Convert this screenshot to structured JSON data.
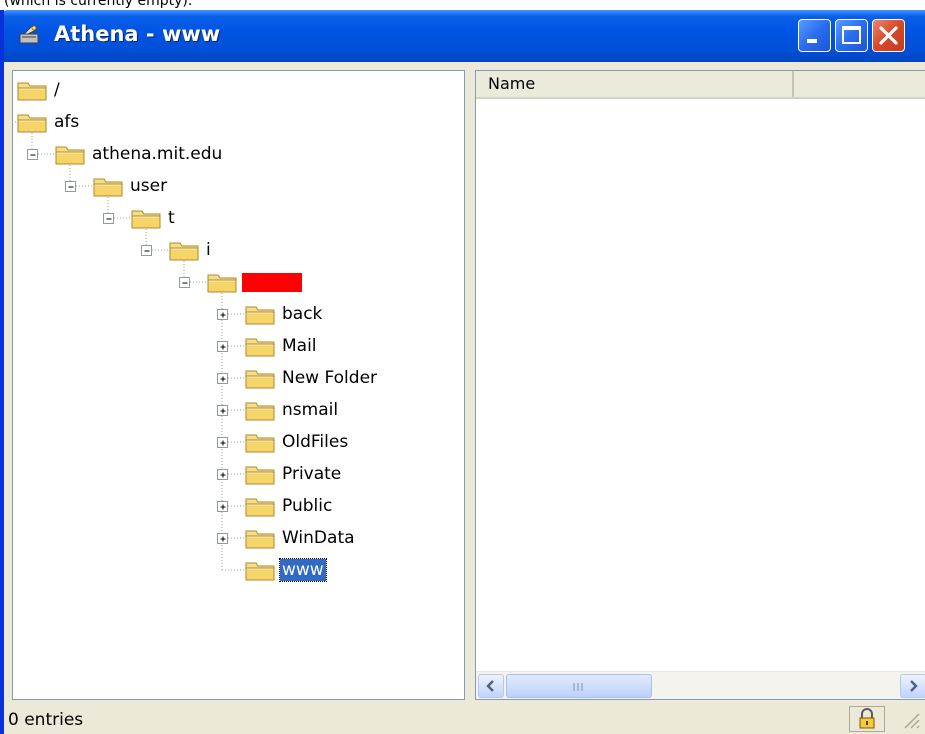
{
  "caption": "(which is currently empty).",
  "window": {
    "title": "Athena - www",
    "app_icon": "athena-app-icon",
    "buttons": {
      "minimize": "minimize-icon",
      "maximize": "maximize-icon",
      "close": "close-icon"
    }
  },
  "tree": {
    "nodes": [
      {
        "label": "/",
        "expander": "none"
      },
      {
        "label": "afs",
        "expander": "minus"
      },
      {
        "label": "athena.mit.edu",
        "expander": "minus"
      },
      {
        "label": "user",
        "expander": "minus"
      },
      {
        "label": "t",
        "expander": "minus"
      },
      {
        "label": "i",
        "expander": "minus"
      },
      {
        "label": "",
        "expander": "minus",
        "redacted": true
      },
      {
        "label": "back",
        "expander": "plus"
      },
      {
        "label": "Mail",
        "expander": "plus"
      },
      {
        "label": "New Folder",
        "expander": "plus"
      },
      {
        "label": "nsmail",
        "expander": "plus"
      },
      {
        "label": "OldFiles",
        "expander": "plus"
      },
      {
        "label": "Private",
        "expander": "plus"
      },
      {
        "label": "Public",
        "expander": "plus"
      },
      {
        "label": "WinData",
        "expander": "plus"
      },
      {
        "label": "www",
        "expander": "none",
        "selected": true
      }
    ]
  },
  "list": {
    "columns": [
      "Name",
      ""
    ],
    "rows": []
  },
  "status": {
    "text": "0 entries",
    "lock_icon": "lock-icon"
  },
  "colors": {
    "titlebar": "#0054e3",
    "selection": "#316ac5",
    "redaction": "#ff0000",
    "folder": "#f5d77a"
  }
}
